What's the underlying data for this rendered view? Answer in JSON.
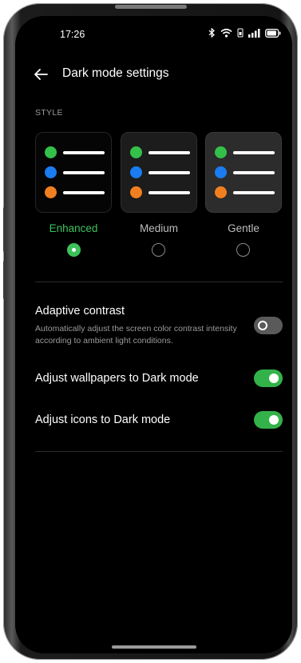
{
  "status_bar": {
    "time": "17:26",
    "icons": [
      "bluetooth-icon",
      "wifi-icon",
      "sim-icon",
      "signal-icon",
      "battery-icon"
    ]
  },
  "header": {
    "title": "Dark mode settings"
  },
  "style_section": {
    "label": "STYLE",
    "options": [
      {
        "label": "Enhanced",
        "selected": true
      },
      {
        "label": "Medium",
        "selected": false
      },
      {
        "label": "Gentle",
        "selected": false
      }
    ],
    "accent_color": "#3dc25a",
    "preview_dot_colors": [
      "#34c14a",
      "#1a7cf0",
      "#f27f1f"
    ]
  },
  "settings": [
    {
      "title": "Adaptive contrast",
      "description": "Automatically adjust the screen color contrast intensity according to ambient light conditions.",
      "enabled": false
    },
    {
      "title": "Adjust wallpapers to Dark mode",
      "enabled": true
    },
    {
      "title": "Adjust icons to Dark mode",
      "enabled": true
    }
  ],
  "colors": {
    "toggle_on": "#34b24a",
    "toggle_off": "#5a5a5a",
    "background": "#000000"
  }
}
